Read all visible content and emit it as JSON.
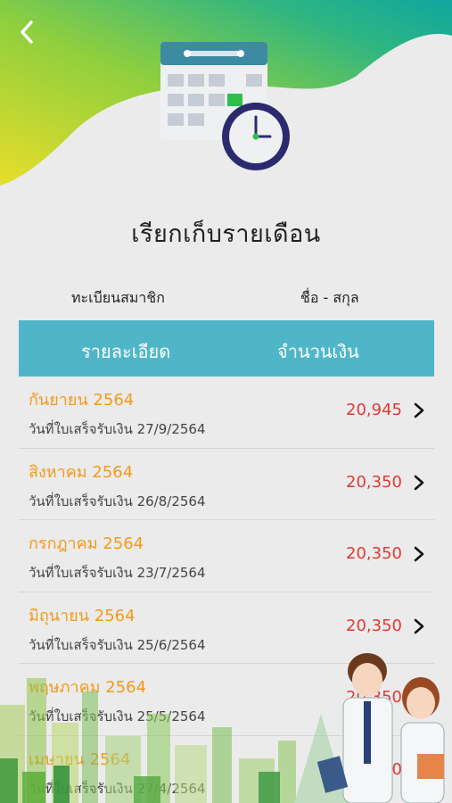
{
  "header": {
    "back_icon": "chevron-left-icon",
    "title": "เรียกเก็บรายเดือน",
    "illustration": "calendar-clock-icon"
  },
  "member": {
    "id_label": "ทะเบียนสมาชิก",
    "name_label": "ชื่อ - สกุล"
  },
  "table": {
    "col_detail": "รายละเอียด",
    "col_amount": "จำนวนเงิน"
  },
  "rows": [
    {
      "month": "กันยายน 2564",
      "receipt": "วันที่ใบเสร็จรับเงิน 27/9/2564",
      "amount": "20,945"
    },
    {
      "month": "สิงหาคม 2564",
      "receipt": "วันที่ใบเสร็จรับเงิน 26/8/2564",
      "amount": "20,350"
    },
    {
      "month": "กรกฎาคม 2564",
      "receipt": "วันที่ใบเสร็จรับเงิน 23/7/2564",
      "amount": "20,350"
    },
    {
      "month": "มิถุนายน 2564",
      "receipt": "วันที่ใบเสร็จรับเงิน 25/6/2564",
      "amount": "20,350"
    },
    {
      "month": "พฤษภาคม 2564",
      "receipt": "วันที่ใบเสร็จรับเงิน 25/5/2564",
      "amount": "20,350"
    },
    {
      "month": "เมษายน 2564",
      "receipt": "วันที่ใบเสร็จรับเงิน 27/4/2564",
      "amount": "20,350"
    }
  ],
  "colors": {
    "accent_teal": "#4fb6c9",
    "month_orange": "#f39a1a",
    "amount_red": "#e03a34",
    "gradient_yellow": "#e5dc2a",
    "gradient_green": "#5cbf6a",
    "gradient_teal": "#14a89a"
  }
}
